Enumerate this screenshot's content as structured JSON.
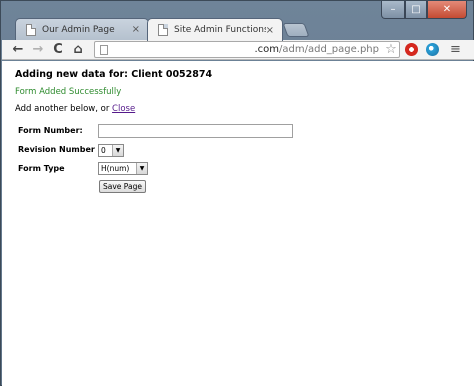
{
  "browser": {
    "tabs": [
      {
        "title": "Our Admin Page",
        "close": "×"
      },
      {
        "title": "Site Admin Functions",
        "close": "×"
      }
    ],
    "nav": {
      "back": "←",
      "forward": "→",
      "reload": "C",
      "home": "⌂"
    },
    "url": {
      "domain": ".com",
      "path": "/adm/add_page.php"
    },
    "star": "☆",
    "menu": "≡",
    "window": {
      "minimize": "–",
      "maximize": "□",
      "close": "✕"
    }
  },
  "page": {
    "heading": "Adding new data for: Client 0052874",
    "success": "Form Added Successfully",
    "another_prefix": "Add another below, or ",
    "close_link": "Close",
    "form": {
      "form_number_label": "Form Number:",
      "form_number_value": "",
      "revision_label": "Revision Number",
      "revision_value": "0",
      "form_type_label": "Form Type",
      "form_type_value": "H(num)",
      "save_label": "Save Page"
    }
  }
}
